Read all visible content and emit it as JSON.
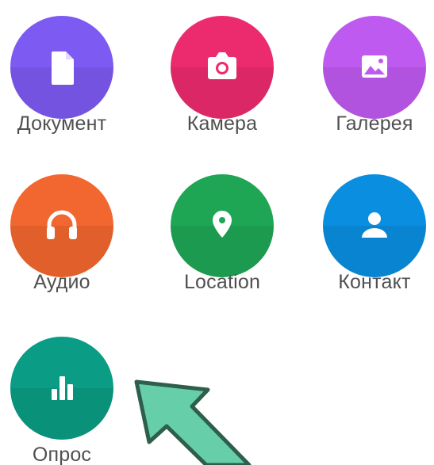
{
  "attach_menu": {
    "items": [
      {
        "label": "Документ",
        "icon": "document-icon",
        "color": "#7D5AF2"
      },
      {
        "label": "Камера",
        "icon": "camera-icon",
        "color": "#EC2A6E"
      },
      {
        "label": "Галерея",
        "icon": "gallery-icon",
        "color": "#BF5AF0"
      },
      {
        "label": "Аудио",
        "icon": "headphones-icon",
        "color": "#F2672F"
      },
      {
        "label": "Location",
        "icon": "location-pin-icon",
        "color": "#1FA655"
      },
      {
        "label": "Контакт",
        "icon": "contact-person-icon",
        "color": "#0A8FE0"
      },
      {
        "label": "Опрос",
        "icon": "poll-chart-icon",
        "color": "#0A9C84"
      }
    ]
  },
  "annotation": {
    "arrow_color": "#66CFAA",
    "arrow_outline": "#2E5E4C"
  }
}
